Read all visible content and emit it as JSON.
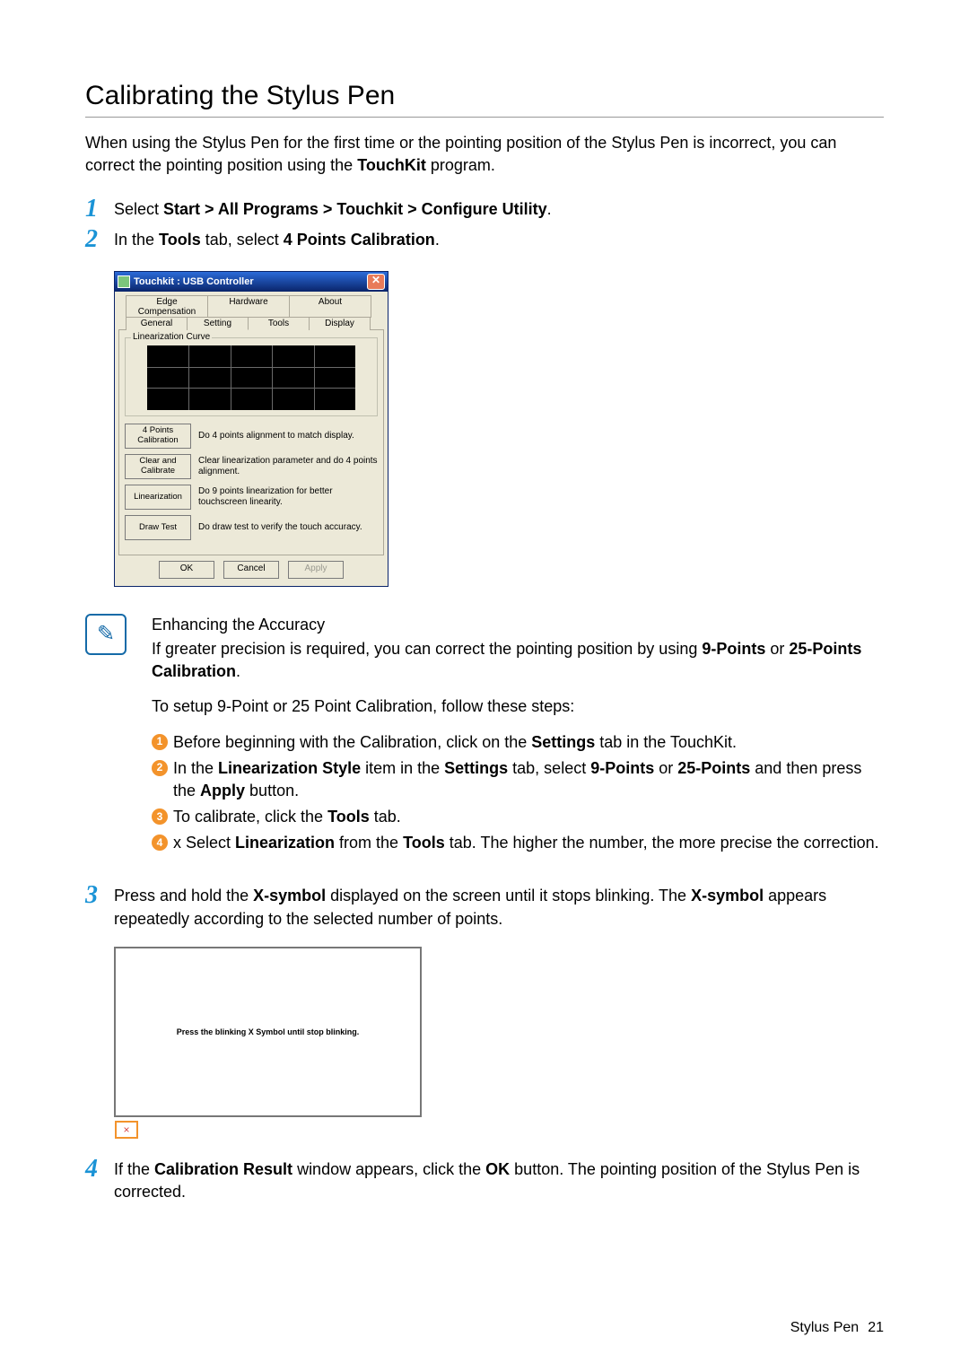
{
  "title": "Calibrating the Stylus Pen",
  "intro": {
    "p1a": "When using the Stylus Pen for the first time or the pointing position of the Stylus Pen is incorrect, you can correct the pointing position using the ",
    "p1b": "TouchKit",
    "p1c": " program."
  },
  "step1": {
    "pre": "Select ",
    "path": "Start > All Programs > Touchkit > Configure Utility",
    "post": "."
  },
  "step2": {
    "pre": "In the ",
    "tab": "Tools",
    "mid": " tab, select ",
    "opt": "4 Points Calibration",
    "post": "."
  },
  "dialog": {
    "title": "Touchkit : USB Controller",
    "tabs_top": [
      "Edge Compensation",
      "Hardware",
      "About"
    ],
    "tabs_bot": [
      "General",
      "Setting",
      "Tools",
      "Display"
    ],
    "group": "Linearization Curve",
    "rows": [
      {
        "btn": "4 Points Calibration",
        "txt": "Do 4 points alignment to match display."
      },
      {
        "btn": "Clear and Calibrate",
        "txt": "Clear linearization parameter and do 4 points alignment."
      },
      {
        "btn": "Linearization",
        "txt": "Do 9 points linearization for better touchscreen linearity."
      },
      {
        "btn": "Draw Test",
        "txt": "Do draw test to verify the touch accuracy."
      }
    ],
    "ok": "OK",
    "cancel": "Cancel",
    "apply": "Apply"
  },
  "note": {
    "heading": "Enhancing the Accuracy",
    "p1a": "If greater precision is required, you can correct the pointing position by using ",
    "p1b": "9-Points",
    "p1c": " or ",
    "p1d": "25-Points Calibration",
    "p1e": ".",
    "p2": "To setup 9-Point or 25 Point Calibration, follow these steps:",
    "b1a": "Before beginning with the Calibration, click on the ",
    "b1b": "Settings",
    "b1c": " tab in the TouchKit.",
    "b2a": "In the ",
    "b2b": "Linearization Style",
    "b2c": " item in the ",
    "b2d": "Settings",
    "b2e": " tab, select ",
    "b2f": "9-Points",
    "b2g": " or ",
    "b2h": "25-Points",
    "b2i": " and then press the ",
    "b2j": "Apply",
    "b2k": " button.",
    "b3a": "To calibrate, click the ",
    "b3b": "Tools",
    "b3c": " tab.",
    "b4a": "x Select ",
    "b4b": "Linearization",
    "b4c": " from the ",
    "b4d": "Tools",
    "b4e": " tab. The higher the number, the more precise the correction."
  },
  "step3": {
    "a": "Press and hold the ",
    "b": "X-symbol",
    "c": " displayed on the screen until it stops blinking. The ",
    "d": "X-symbol",
    "e": " appears repeatedly according to the selected number of points."
  },
  "calib_msg": "Press the blinking X Symbol until stop blinking.",
  "step4": {
    "a": "If the ",
    "b": "Calibration Result",
    "c": " window appears, click the ",
    "d": "OK",
    "e": " button. The pointing position of the Stylus Pen is corrected."
  },
  "footer": {
    "section": "Stylus Pen",
    "page": "21"
  }
}
